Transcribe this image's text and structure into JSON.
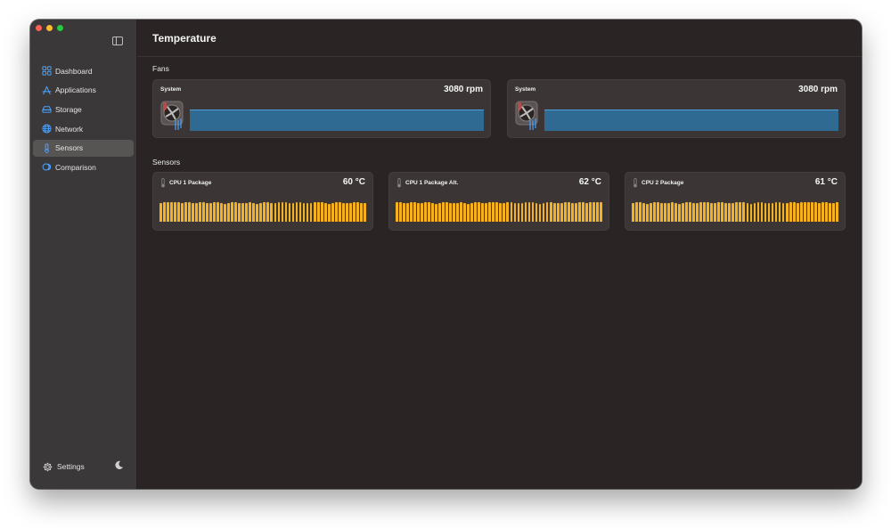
{
  "app": {
    "title": "Temperature"
  },
  "colors": {
    "accent": "#4aa3ff",
    "fan_bar": "#2f6a93",
    "sensor_bar": "#f5b21e"
  },
  "sidebar": {
    "items": [
      {
        "label": "Dashboard",
        "icon": "grid-icon",
        "active": false
      },
      {
        "label": "Applications",
        "icon": "app-store-icon",
        "active": false
      },
      {
        "label": "Storage",
        "icon": "drive-icon",
        "active": false
      },
      {
        "label": "Network",
        "icon": "globe-icon",
        "active": false
      },
      {
        "label": "Sensors",
        "icon": "thermometer-icon",
        "active": true
      },
      {
        "label": "Comparison",
        "icon": "stack-icon",
        "active": false
      }
    ],
    "settings_label": "Settings"
  },
  "fans": {
    "section_title": "Fans",
    "cards": [
      {
        "name": "System",
        "value": "3080 rpm",
        "level": 1.0
      },
      {
        "name": "System",
        "value": "3080 rpm",
        "level": 1.0
      }
    ]
  },
  "sensors": {
    "section_title": "Sensors",
    "cards": [
      {
        "name": "CPU 1 Package",
        "value": "60 °C"
      },
      {
        "name": "CPU 1 Package Alt.",
        "value": "62 °C"
      },
      {
        "name": "CPU 2 Package",
        "value": "61 °C"
      }
    ]
  }
}
